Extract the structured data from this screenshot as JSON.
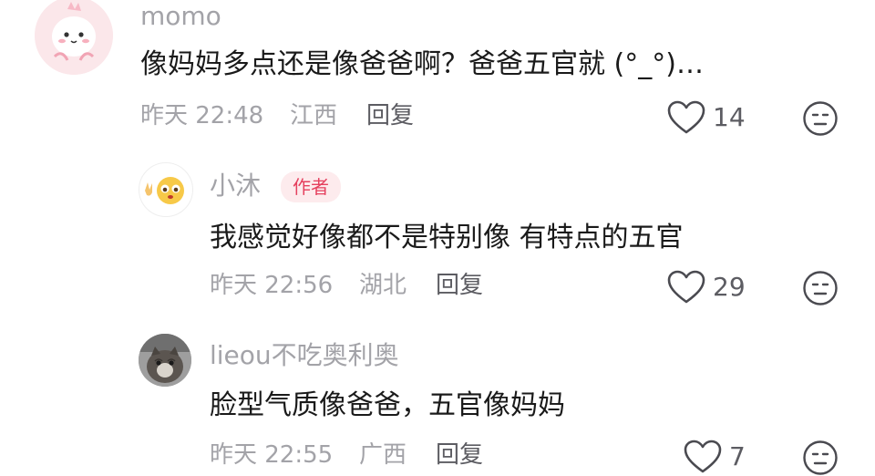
{
  "comments": [
    {
      "username": "momo",
      "text": "像妈妈多点还是像爸爸啊？爸爸五官就 (°_°)…",
      "time": "昨天 22:48",
      "location": "江西",
      "reply_label": "回复",
      "likes": "14",
      "avatar_icon": "pink-dinosaur-avatar"
    },
    {
      "username": "小沐",
      "badge": "作者",
      "text": "我感觉好像都不是特别像 有特点的五官",
      "time": "昨天 22:56",
      "location": "湖北",
      "reply_label": "回复",
      "likes": "29",
      "avatar_icon": "peace-emoji-avatar"
    },
    {
      "username": "lieou不吃奥利奥",
      "text": "脸型气质像爸爸，五官像妈妈",
      "time": "昨天 22:55",
      "location": "广西",
      "reply_label": "回复",
      "likes": "7",
      "avatar_icon": "cat-photo-avatar"
    }
  ],
  "colors": {
    "text_primary": "#1a1a1a",
    "text_secondary": "#a3a3a8",
    "badge_bg": "#fdebed",
    "badge_text": "#e5405e"
  }
}
